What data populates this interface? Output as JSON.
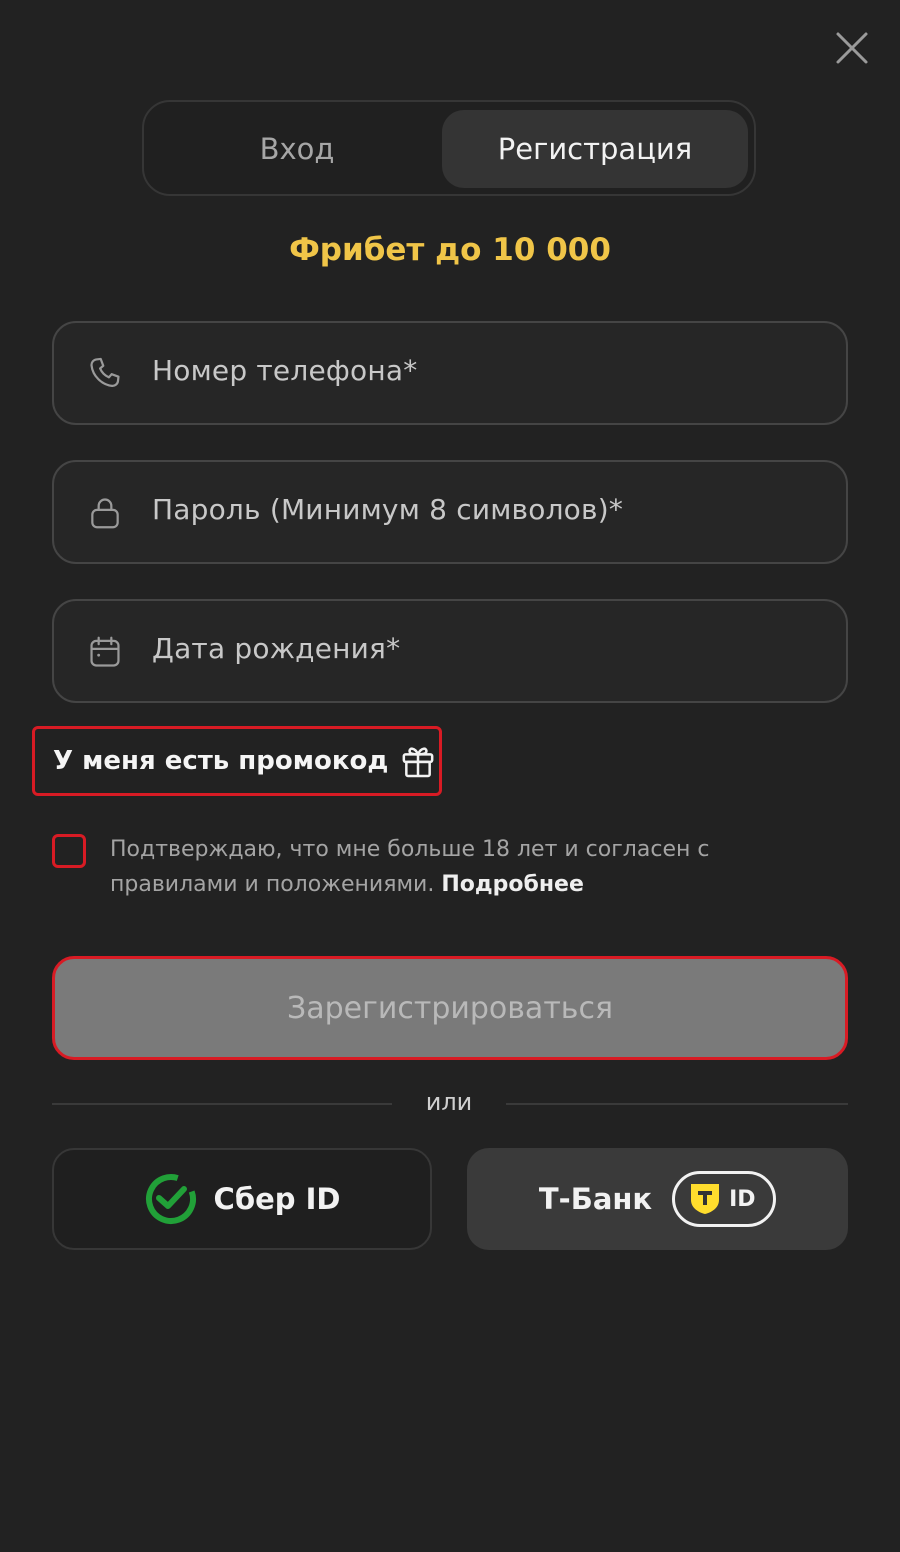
{
  "tabs": {
    "login": "Вход",
    "register": "Регистрация",
    "active": "register"
  },
  "promo": {
    "title": "Фрибет до 10 000",
    "color": "#f0c548"
  },
  "form": {
    "phone_placeholder": "Номер телефона*",
    "password_placeholder": "Пароль (Минимум 8 символов)*",
    "birthdate_placeholder": "Дата рождения*",
    "promo_code_link": "У меня есть промокод",
    "consent_text": "Подтверждаю, что мне больше 18 лет и согласен с правилами и положениями.",
    "consent_more": "Подробнее",
    "consent_checked": false,
    "submit_label": "Зарегистрироваться"
  },
  "divider": {
    "text": "или"
  },
  "social": {
    "sber_label": "Сбер ID",
    "tbank_label": "Т-Банк",
    "tbank_badge_text": "ID"
  },
  "icons": {
    "close": "close-icon",
    "phone": "phone-icon",
    "password": "lock-icon",
    "birthdate": "calendar-icon",
    "promo": "gift-icon",
    "sber": "sber-logo-icon",
    "tbank": "tbank-shield-icon"
  },
  "colors": {
    "background": "#222222",
    "error_outline": "#d81b24",
    "sber_green": "#21a038",
    "tbank_yellow": "#ffdd2d"
  }
}
